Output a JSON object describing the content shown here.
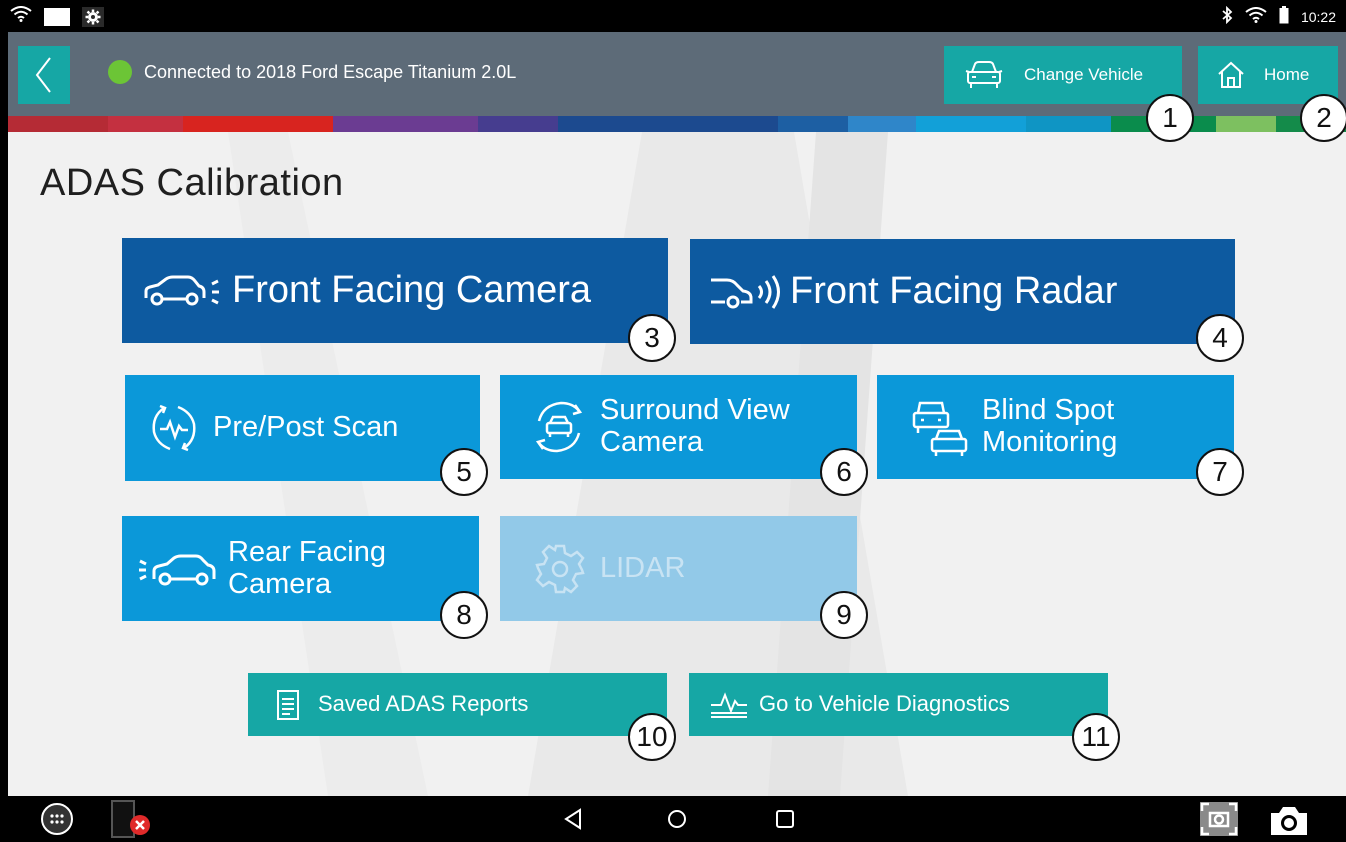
{
  "status_bar": {
    "time": "10:22"
  },
  "header": {
    "connection_text": "Connected to 2018 Ford Escape Titanium 2.0L",
    "change_vehicle_label": "Change Vehicle",
    "home_label": "Home"
  },
  "page": {
    "title": "ADAS Calibration"
  },
  "tiles": {
    "front_camera": "Front Facing Camera",
    "front_radar": "Front Facing Radar",
    "pre_post_scan": "Pre/Post Scan",
    "surround_view_1": "Surround View",
    "surround_view_2": "Camera",
    "blind_spot_1": "Blind Spot",
    "blind_spot_2": "Monitoring",
    "rear_camera_1": "Rear Facing",
    "rear_camera_2": "Camera",
    "lidar": "LIDAR",
    "saved_reports": "Saved ADAS Reports",
    "vehicle_diagnostics": "Go to Vehicle Diagnostics"
  },
  "callouts": [
    "1",
    "2",
    "3",
    "4",
    "5",
    "6",
    "7",
    "8",
    "9",
    "10",
    "11"
  ],
  "colors": {
    "header_bg": "#5d6b78",
    "teal": "#16a7a5",
    "dark_blue": "#0d5aa0",
    "mid_blue": "#0b98d9",
    "disabled_blue": "#92c9e8",
    "connected_green": "#6cc536"
  },
  "icons": {
    "status": [
      "wifi-icon",
      "gear-icon",
      "bluetooth-icon",
      "battery-icon"
    ],
    "nav": [
      "apps-icon",
      "app-close-icon",
      "back-triangle-icon",
      "home-circle-icon",
      "recents-square-icon",
      "screenshot-icon",
      "camera-icon"
    ]
  }
}
